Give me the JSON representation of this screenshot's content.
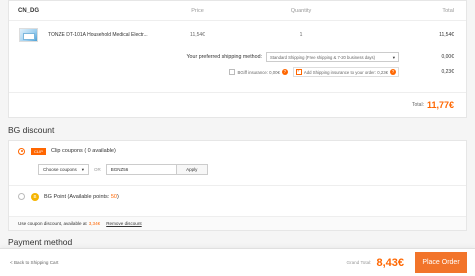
{
  "cart": {
    "store_name": "CN_DG",
    "columns": {
      "price": "Price",
      "quantity": "Quantity",
      "total": "Total"
    },
    "item": {
      "name": "TONZE DT-101A Household Medical Electr...",
      "price": "11,54€",
      "quantity": "1",
      "total": "11,54€"
    },
    "shipping": {
      "label": "Your preferred shipping method:",
      "selected": "Standard Shipping (Free shipping & 7-20 business days)",
      "value": "0,00€"
    },
    "insurance": {
      "bgiff_label": "BGiff insurance: 0,00€",
      "shipping_label": "Add Shipping insurance to your order: 0,23€",
      "value": "0,23€"
    },
    "total_label": "Total:",
    "total_value": "11,77€"
  },
  "discount": {
    "title": "BG discount",
    "clip_icon_text": "CLIP",
    "clip_label": "Clip coupons ( 0 available)",
    "coupon_select": "Choose coupons",
    "or_text": "OR",
    "coupon_code": "BGNZ56",
    "apply_label": "Apply",
    "points_icon_text": "B",
    "points_label": "BG Point (Available points:",
    "points_value": "50",
    "points_close": ")",
    "use_text": "Use coupon discount, available at",
    "use_amount": "3,34€",
    "remove_label": "Remove discount"
  },
  "payment": {
    "title": "Payment method"
  },
  "footer": {
    "back_label": "< Back to Shipping Cart",
    "grand_label": "Grand Total:",
    "grand_value": "8,43€",
    "place_label": "Place Order"
  },
  "colors": {
    "accent": "#ff6600",
    "button": "#f2742a"
  }
}
